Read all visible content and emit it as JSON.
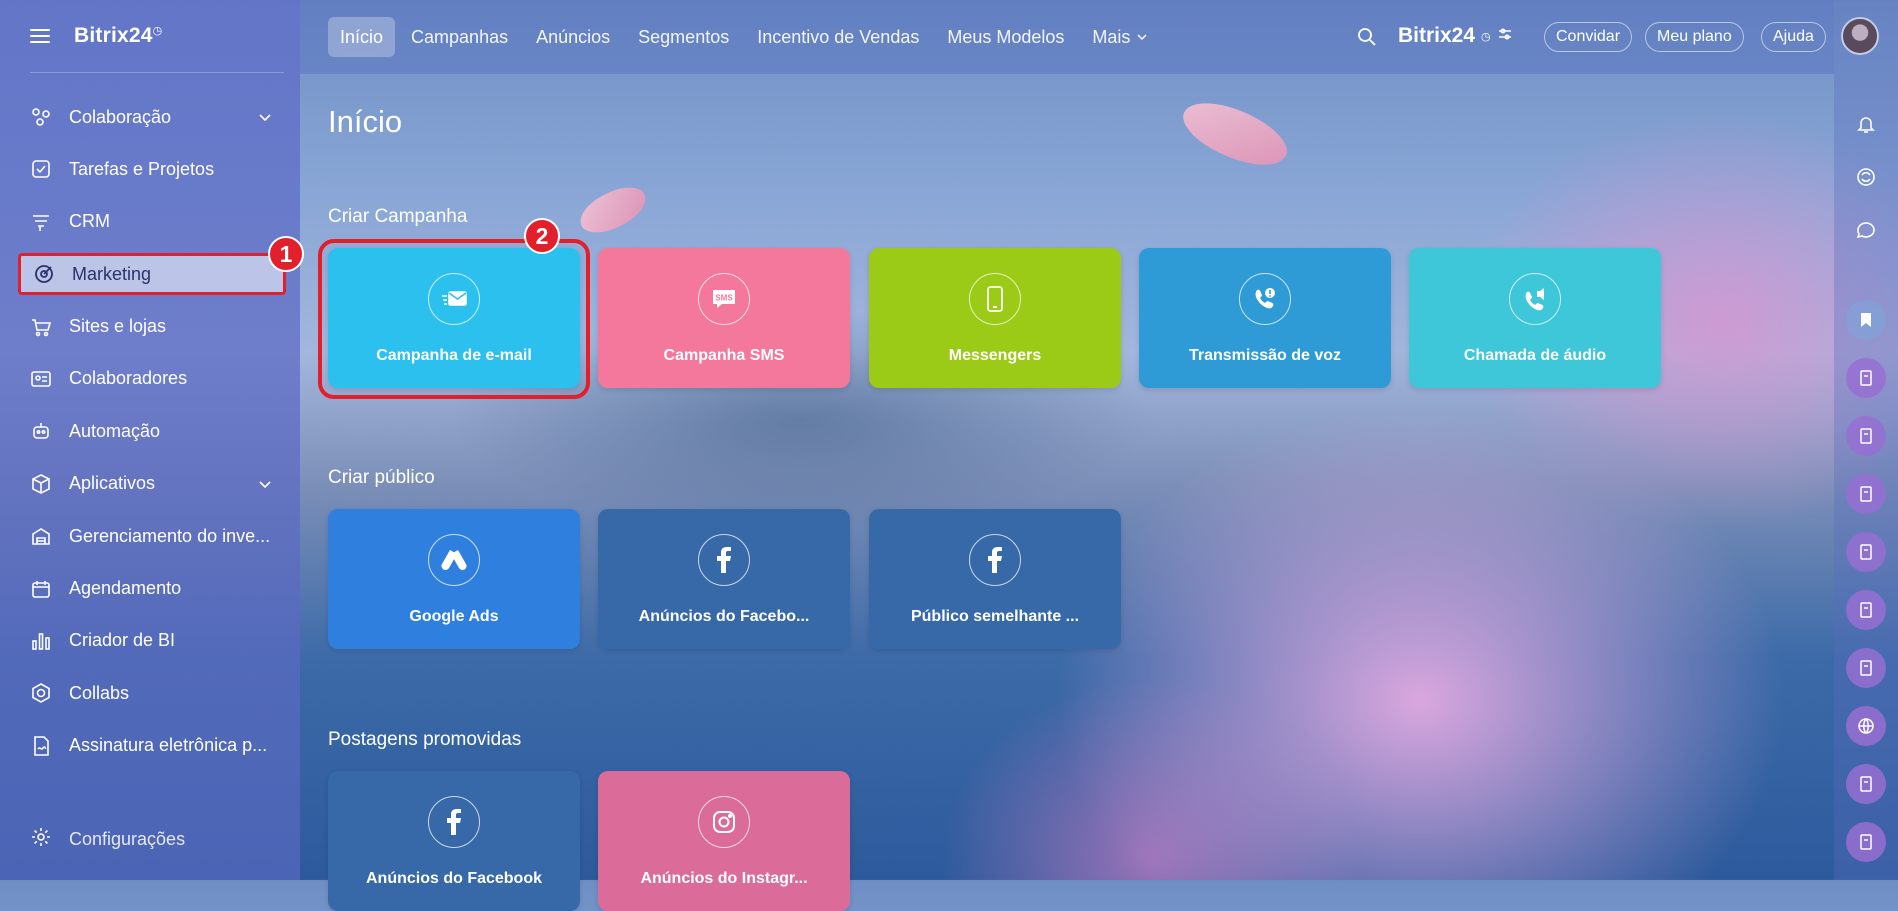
{
  "sidebar": {
    "brand": "Bitrix24",
    "items": [
      {
        "label": "Colaboração",
        "icon": "collaboration-icon",
        "has_chevron": true
      },
      {
        "label": "Tarefas e Projetos",
        "icon": "tasks-icon"
      },
      {
        "label": "CRM",
        "icon": "crm-icon"
      },
      {
        "label": "Marketing",
        "icon": "marketing-icon",
        "active": true
      },
      {
        "label": "Sites e lojas",
        "icon": "cart-icon"
      },
      {
        "label": "Colaboradores",
        "icon": "employees-icon"
      },
      {
        "label": "Automação",
        "icon": "robot-icon"
      },
      {
        "label": "Aplicativos",
        "icon": "apps-icon",
        "has_chevron": true
      },
      {
        "label": "Gerenciamento do inve...",
        "icon": "inventory-icon"
      },
      {
        "label": "Agendamento",
        "icon": "calendar-icon"
      },
      {
        "label": "Criador de BI",
        "icon": "bi-chart-icon"
      },
      {
        "label": "Collabs",
        "icon": "collabs-icon"
      },
      {
        "label": "Assinatura eletrônica p...",
        "icon": "signature-icon"
      }
    ],
    "settings_label": "Configurações"
  },
  "topbar": {
    "tabs": [
      "Início",
      "Campanhas",
      "Anúncios",
      "Segmentos",
      "Incentivo de Vendas",
      "Meus Modelos",
      "Mais"
    ],
    "active_tab": "Início",
    "brand": "Bitrix24",
    "invite_label": "Convidar",
    "plan_label": "Meu plano",
    "help_label": "Ajuda"
  },
  "main": {
    "title": "Início",
    "sections": [
      {
        "title": "Criar Campanha",
        "tiles": [
          {
            "label": "Campanha de e-mail",
            "color": "#2cc0ef",
            "icon": "email-icon"
          },
          {
            "label": "Campanha SMS",
            "color": "#f4789c",
            "icon": "sms-icon"
          },
          {
            "label": "Messengers",
            "color": "#9bcb16",
            "icon": "phone-icon"
          },
          {
            "label": "Transmissão de voz",
            "color": "#2e9bd6",
            "icon": "voice-broadcast-icon"
          },
          {
            "label": "Chamada de áudio",
            "color": "#3ec6d9",
            "icon": "audio-call-icon"
          }
        ]
      },
      {
        "title": "Criar público",
        "tiles": [
          {
            "label": "Google Ads",
            "color": "#2f80de",
            "icon": "google-ads-icon"
          },
          {
            "label": "Anúncios do Facebo...",
            "color": "#3768a8",
            "icon": "facebook-icon"
          },
          {
            "label": "Público semelhante ...",
            "color": "#3768a8",
            "icon": "facebook-icon"
          }
        ]
      },
      {
        "title": "Postagens promovidas",
        "tiles": [
          {
            "label": "Anúncios do Facebook",
            "color": "#3768a8",
            "icon": "facebook-icon"
          },
          {
            "label": "Anúncios do Instagr...",
            "color": "#db6c9a",
            "icon": "instagram-icon"
          }
        ]
      }
    ]
  },
  "callouts": [
    "1",
    "2"
  ],
  "colors": {
    "highlight": "#e2202c"
  }
}
